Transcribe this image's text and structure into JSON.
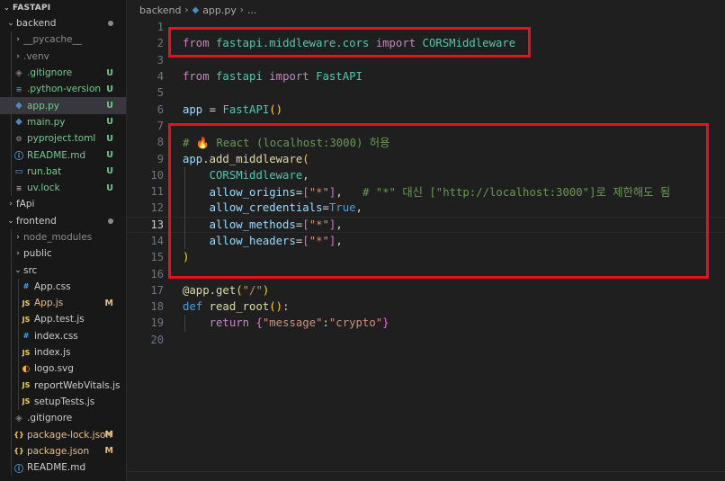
{
  "explorer": {
    "root_label": "FASTAPI",
    "items": [
      {
        "label": "backend",
        "kind": "folder",
        "open": true,
        "depth": 0,
        "status": "dot",
        "icon": ""
      },
      {
        "label": "__pycache__",
        "kind": "folder",
        "open": false,
        "depth": 1,
        "status": "",
        "icon": ""
      },
      {
        "label": ".venv",
        "kind": "folder",
        "open": false,
        "depth": 1,
        "status": "",
        "icon": ""
      },
      {
        "label": ".gitignore",
        "kind": "file",
        "depth": 1,
        "status": "U",
        "icon": "git-icon"
      },
      {
        "label": ".python-version",
        "kind": "file",
        "depth": 1,
        "status": "U",
        "icon": "python-version-icon"
      },
      {
        "label": "app.py",
        "kind": "file",
        "depth": 1,
        "status": "U",
        "icon": "python-icon",
        "selected": true
      },
      {
        "label": "main.py",
        "kind": "file",
        "depth": 1,
        "status": "U",
        "icon": "python-icon"
      },
      {
        "label": "pyproject.toml",
        "kind": "file",
        "depth": 1,
        "status": "U",
        "icon": "toml-icon"
      },
      {
        "label": "README.md",
        "kind": "file",
        "depth": 1,
        "status": "U",
        "icon": "info-icon"
      },
      {
        "label": "run.bat",
        "kind": "file",
        "depth": 1,
        "status": "U",
        "icon": "bat-icon"
      },
      {
        "label": "uv.lock",
        "kind": "file",
        "depth": 1,
        "status": "U",
        "icon": "lock-icon"
      },
      {
        "label": "fApi",
        "kind": "folder",
        "open": false,
        "depth": 0,
        "status": "",
        "icon": ""
      },
      {
        "label": "frontend",
        "kind": "folder",
        "open": true,
        "depth": 0,
        "status": "dot",
        "icon": ""
      },
      {
        "label": "node_modules",
        "kind": "folder",
        "open": false,
        "depth": 1,
        "status": "",
        "icon": ""
      },
      {
        "label": "public",
        "kind": "folder",
        "open": false,
        "depth": 1,
        "status": "",
        "icon": ""
      },
      {
        "label": "src",
        "kind": "folder",
        "open": true,
        "depth": 1,
        "status": "",
        "icon": ""
      },
      {
        "label": "App.css",
        "kind": "file",
        "depth": 2,
        "status": "",
        "icon": "css-icon"
      },
      {
        "label": "App.js",
        "kind": "file",
        "depth": 2,
        "status": "M",
        "icon": "js-icon"
      },
      {
        "label": "App.test.js",
        "kind": "file",
        "depth": 2,
        "status": "",
        "icon": "js-icon"
      },
      {
        "label": "index.css",
        "kind": "file",
        "depth": 2,
        "status": "",
        "icon": "css-icon"
      },
      {
        "label": "index.js",
        "kind": "file",
        "depth": 2,
        "status": "",
        "icon": "js-icon"
      },
      {
        "label": "logo.svg",
        "kind": "file",
        "depth": 2,
        "status": "",
        "icon": "svg-icon"
      },
      {
        "label": "reportWebVitals.js",
        "kind": "file",
        "depth": 2,
        "status": "",
        "icon": "js-icon"
      },
      {
        "label": "setupTests.js",
        "kind": "file",
        "depth": 2,
        "status": "",
        "icon": "js-icon"
      },
      {
        "label": ".gitignore",
        "kind": "file",
        "depth": 1,
        "status": "",
        "icon": "git-icon"
      },
      {
        "label": "package-lock.json",
        "kind": "file",
        "depth": 1,
        "status": "M",
        "icon": "json-icon"
      },
      {
        "label": "package.json",
        "kind": "file",
        "depth": 1,
        "status": "M",
        "icon": "json-icon"
      },
      {
        "label": "README.md",
        "kind": "file",
        "depth": 1,
        "status": "",
        "icon": "info-icon"
      }
    ]
  },
  "breadcrumb": {
    "folder": "backend",
    "file": "app.py",
    "more": "..."
  },
  "editor": {
    "current_line": 13,
    "lines": [
      {
        "n": "1",
        "tokens": []
      },
      {
        "n": "2",
        "tokens": [
          [
            "k",
            "from"
          ],
          [
            "p",
            " "
          ],
          [
            "m",
            "fastapi.middleware.cors"
          ],
          [
            "p",
            " "
          ],
          [
            "k",
            "import"
          ],
          [
            "p",
            " "
          ],
          [
            "m",
            "CORSMiddleware"
          ]
        ]
      },
      {
        "n": "3",
        "tokens": []
      },
      {
        "n": "4",
        "tokens": [
          [
            "k",
            "from"
          ],
          [
            "p",
            " "
          ],
          [
            "m",
            "fastapi"
          ],
          [
            "p",
            " "
          ],
          [
            "k",
            "import"
          ],
          [
            "p",
            " "
          ],
          [
            "m",
            "FastAPI"
          ]
        ]
      },
      {
        "n": "5",
        "tokens": []
      },
      {
        "n": "6",
        "tokens": [
          [
            "v",
            "app"
          ],
          [
            "p",
            " = "
          ],
          [
            "m",
            "FastAPI"
          ],
          [
            "br",
            "()"
          ]
        ]
      },
      {
        "n": "7",
        "tokens": []
      },
      {
        "n": "8",
        "tokens": [
          [
            "c",
            "# 🔥 React (localhost:3000) 허용"
          ]
        ]
      },
      {
        "n": "9",
        "tokens": [
          [
            "v",
            "app"
          ],
          [
            "p",
            "."
          ],
          [
            "f",
            "add_middleware"
          ],
          [
            "br",
            "("
          ]
        ]
      },
      {
        "n": "10",
        "tokens": [
          [
            "p",
            "    "
          ],
          [
            "m",
            "CORSMiddleware"
          ],
          [
            "p",
            ","
          ]
        ]
      },
      {
        "n": "11",
        "tokens": [
          [
            "p",
            "    "
          ],
          [
            "v",
            "allow_origins"
          ],
          [
            "p",
            "="
          ],
          [
            "br2",
            "["
          ],
          [
            "s",
            "\"*\""
          ],
          [
            "br2",
            "]"
          ],
          [
            "p",
            ",   "
          ],
          [
            "c",
            "# \"*\" 대신 [\"http://localhost:3000\"]로 제한해도 됨"
          ]
        ]
      },
      {
        "n": "12",
        "tokens": [
          [
            "p",
            "    "
          ],
          [
            "v",
            "allow_credentials"
          ],
          [
            "p",
            "="
          ],
          [
            "kb",
            "True"
          ],
          [
            "p",
            ","
          ]
        ]
      },
      {
        "n": "13",
        "tokens": [
          [
            "p",
            "    "
          ],
          [
            "v",
            "allow_methods"
          ],
          [
            "p",
            "="
          ],
          [
            "br2",
            "["
          ],
          [
            "s",
            "\"*\""
          ],
          [
            "br2",
            "]"
          ],
          [
            "p",
            ","
          ]
        ]
      },
      {
        "n": "14",
        "tokens": [
          [
            "p",
            "    "
          ],
          [
            "v",
            "allow_headers"
          ],
          [
            "p",
            "="
          ],
          [
            "br2",
            "["
          ],
          [
            "s",
            "\"*\""
          ],
          [
            "br2",
            "]"
          ],
          [
            "p",
            ","
          ]
        ]
      },
      {
        "n": "15",
        "tokens": [
          [
            "br",
            ")"
          ]
        ]
      },
      {
        "n": "16",
        "tokens": []
      },
      {
        "n": "17",
        "tokens": [
          [
            "f",
            "@app.get"
          ],
          [
            "br",
            "("
          ],
          [
            "s",
            "\"/\""
          ],
          [
            "br",
            ")"
          ]
        ]
      },
      {
        "n": "18",
        "tokens": [
          [
            "kb",
            "def"
          ],
          [
            "p",
            " "
          ],
          [
            "f",
            "read_root"
          ],
          [
            "br",
            "()"
          ],
          [
            "p",
            ":"
          ]
        ]
      },
      {
        "n": "19",
        "tokens": [
          [
            "p",
            "    "
          ],
          [
            "k",
            "return"
          ],
          [
            "p",
            " "
          ],
          [
            "br2",
            "{"
          ],
          [
            "s",
            "\"message\""
          ],
          [
            "p",
            ":"
          ],
          [
            "s",
            "\"crypto\""
          ],
          [
            "br2",
            "}"
          ]
        ]
      },
      {
        "n": "20",
        "tokens": []
      }
    ]
  },
  "colors": {
    "highlight_box": "#e8101e",
    "status_untracked": "#73c991",
    "status_modified": "#e2c08d"
  }
}
